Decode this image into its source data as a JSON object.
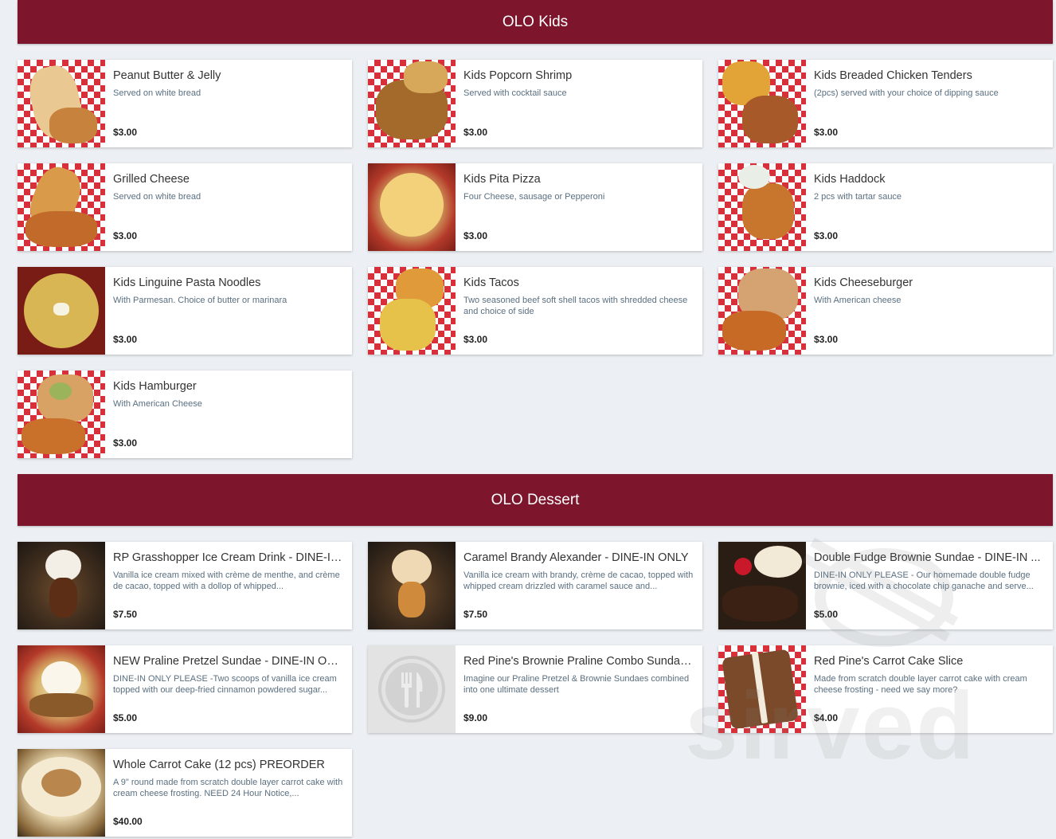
{
  "sections": [
    {
      "title": "OLO Kids",
      "items": [
        {
          "name": "Peanut Butter & Jelly",
          "desc": "Served on white bread",
          "price": "$3.00"
        },
        {
          "name": "Kids Popcorn Shrimp",
          "desc": "Served with cocktail sauce",
          "price": "$3.00"
        },
        {
          "name": "Kids Breaded Chicken Tenders",
          "desc": "(2pcs) served with your choice of dipping sauce",
          "price": "$3.00"
        },
        {
          "name": "Grilled Cheese",
          "desc": "Served on white bread",
          "price": "$3.00"
        },
        {
          "name": "Kids Pita Pizza",
          "desc": "Four Cheese, sausage or Pepperoni",
          "price": "$3.00"
        },
        {
          "name": "Kids Haddock",
          "desc": "2 pcs with tartar sauce",
          "price": "$3.00"
        },
        {
          "name": "Kids Linguine Pasta Noodles",
          "desc": "With Parmesan. Choice of butter or marinara",
          "price": "$3.00"
        },
        {
          "name": "Kids Tacos",
          "desc": "Two seasoned beef soft shell tacos with shredded cheese and choice of side",
          "price": "$3.00"
        },
        {
          "name": "Kids Cheeseburger",
          "desc": "With American cheese",
          "price": "$3.00"
        },
        {
          "name": "Kids Hamburger",
          "desc": "With American Cheese",
          "price": "$3.00"
        }
      ]
    },
    {
      "title": "OLO Dessert",
      "items": [
        {
          "name": "RP Grasshopper Ice Cream Drink - DINE-IN...",
          "desc": "Vanilla ice cream mixed with crème de menthe, and crème de cacao, topped with a dollop of whipped...",
          "price": "$7.50"
        },
        {
          "name": "Caramel Brandy Alexander - DINE-IN ONLY",
          "desc": "Vanilla ice cream with brandy, crème de cacao, topped with whipped cream drizzled with caramel sauce and...",
          "price": "$7.50"
        },
        {
          "name": "Double Fudge Brownie Sundae - DINE-IN ...",
          "desc": "DINE-IN ONLY PLEASE - Our homemade double fudge brownie, iced with a chocolate chip ganache and serve...",
          "price": "$5.00"
        },
        {
          "name": "NEW Praline Pretzel Sundae - DINE-IN ONLY",
          "desc": "DINE-IN ONLY PLEASE -Two scoops of vanilla ice cream topped with our deep-fried cinnamon powdered sugar...",
          "price": "$5.00"
        },
        {
          "name": "Red Pine's Brownie Praline Combo Sundae...",
          "desc": "Imagine our Praline Pretzel & Brownie Sundaes combined into one ultimate dessert",
          "price": "$9.00"
        },
        {
          "name": "Red Pine's Carrot Cake Slice",
          "desc": "Made from scratch double layer carrot cake with cream cheese frosting - need we say more?",
          "price": "$4.00"
        },
        {
          "name": "Whole Carrot Cake (12 pcs) PREORDER",
          "desc": "A 9\" round made from scratch double layer carrot cake with cream cheese frosting. NEED 24 Hour Notice,...",
          "price": "$40.00"
        }
      ]
    }
  ],
  "watermark": "sirved",
  "colors": {
    "header_bg": "#7d162c",
    "page_bg": "#eceff3",
    "desc_text": "#5a6f80"
  }
}
